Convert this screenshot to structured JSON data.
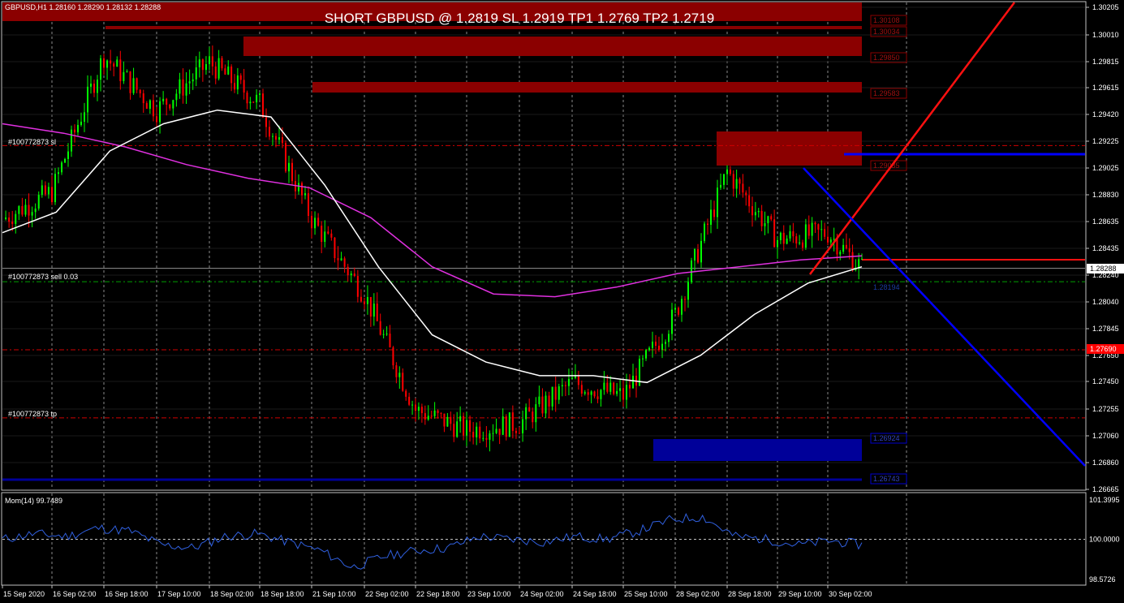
{
  "symbol_info": "GBPUSD,H1  1.28160 1.28290 1.28132 1.28288",
  "headline": "SHORT GBPUSD @ 1.2819 SL 1.2919 TP1 1.2769 TP2 1.2719",
  "trade_labels": {
    "sl": "#100772873 sl",
    "sell": "#100772873 sell 0.03",
    "tp": "#100772873 tp"
  },
  "zone_labels": [
    "1.30108",
    "1.30034",
    "1.29850",
    "1.29583",
    "1.29035",
    "1.26924",
    "1.26743"
  ],
  "bid_price_label": "1.28288",
  "target_price_label": "1.27690",
  "entry_price_label": "1.28194",
  "indicator_label": "Mom(14) 99.7489",
  "colors": {
    "background": "#000000",
    "bull": "#00ff00",
    "bear": "#ff0000",
    "ma_fast": "#ffffff",
    "ma_slow": "#e030e0",
    "supply_zone": "#8b0000",
    "demand_zone": "#000099",
    "trend_line_red": "#ff1010",
    "trend_line_blue": "#0000ff",
    "momentum": "#3060e0"
  },
  "chart_data": [
    {
      "type": "candlestick",
      "title": "GBPUSD,H1",
      "x_labels": [
        "15 Sep 2020",
        "16 Sep 02:00",
        "16 Sep 18:00",
        "17 Sep 10:00",
        "18 Sep 02:00",
        "18 Sep 18:00",
        "21 Sep 10:00",
        "22 Sep 02:00",
        "22 Sep 18:00",
        "23 Sep 10:00",
        "24 Sep 02:00",
        "24 Sep 18:00",
        "25 Sep 10:00",
        "28 Sep 02:00",
        "28 Sep 18:00",
        "29 Sep 10:00",
        "30 Sep 02:00"
      ],
      "y_ticks": [
        "1.30205",
        "1.30010",
        "1.29815",
        "1.29615",
        "1.29420",
        "1.29225",
        "1.29025",
        "1.28830",
        "1.28635",
        "1.28435",
        "1.28240",
        "1.28040",
        "1.27845",
        "1.27650",
        "1.27450",
        "1.27255",
        "1.27060",
        "1.26860",
        "1.26665"
      ],
      "ylim": [
        1.2664,
        1.3035
      ],
      "grid": true,
      "key_prices": {
        "current_bid": 1.28288,
        "stop_loss": 1.2919,
        "entry": 1.2819,
        "tp1": 1.2769,
        "tp2": 1.2719
      },
      "ohlc_anchors": [
        {
          "t": "15 Sep 2020",
          "close": 1.2865
        },
        {
          "t": "16 Sep 02:00",
          "close": 1.2885
        },
        {
          "t": "16 Sep 12:00",
          "close": 1.2985
        },
        {
          "t": "17 Sep 10:00",
          "close": 1.2945
        },
        {
          "t": "18 Sep 02:00",
          "close": 1.298
        },
        {
          "t": "18 Sep 18:00",
          "close": 1.295
        },
        {
          "t": "21 Sep 10:00",
          "close": 1.2865
        },
        {
          "t": "22 Sep 02:00",
          "close": 1.281
        },
        {
          "t": "22 Sep 18:00",
          "close": 1.2725
        },
        {
          "t": "23 Sep 10:00",
          "close": 1.271
        },
        {
          "t": "24 Sep 02:00",
          "close": 1.2715
        },
        {
          "t": "24 Sep 18:00",
          "close": 1.2745
        },
        {
          "t": "25 Sep 10:00",
          "close": 1.2735
        },
        {
          "t": "28 Sep 02:00",
          "close": 1.2795
        },
        {
          "t": "28 Sep 10:00",
          "close": 1.29
        },
        {
          "t": "28 Sep 18:00",
          "close": 1.285
        },
        {
          "t": "29 Sep 10:00",
          "close": 1.2855
        },
        {
          "t": "30 Sep 02:00",
          "close": 1.2829
        }
      ],
      "series": [
        {
          "values": [
            1.2935,
            1.2928,
            1.2918,
            1.2905,
            1.2895,
            1.2888,
            1.2866,
            1.283,
            1.281,
            1.2808,
            1.2815,
            1.2825,
            1.283,
            1.2835,
            1.2838
          ]
        },
        {
          "values": [
            1.2855,
            1.287,
            1.2915,
            1.2935,
            1.2945,
            1.294,
            1.289,
            1.283,
            1.278,
            1.276,
            1.275,
            1.275,
            1.2745,
            1.2765,
            1.2795,
            1.2818,
            1.283
          ]
        }
      ]
    },
    {
      "type": "line",
      "title": "Mom(14)",
      "y_ticks": [
        "101.3995",
        "100.0000",
        "98.5726"
      ],
      "ylim": [
        98.5726,
        101.3995
      ],
      "reference": 100.0,
      "series": [
        {
          "values": [
            100.0,
            100.2,
            100.1,
            100.4,
            100.3,
            99.8,
            99.7,
            100.1,
            100.2,
            99.9,
            99.6,
            99.0,
            99.4,
            99.6,
            99.7,
            100.1,
            100.0,
            99.9,
            100.1,
            100.0,
            100.3,
            100.7,
            100.8,
            100.1,
            100.0,
            99.8,
            99.95,
            99.8
          ]
        }
      ]
    }
  ]
}
